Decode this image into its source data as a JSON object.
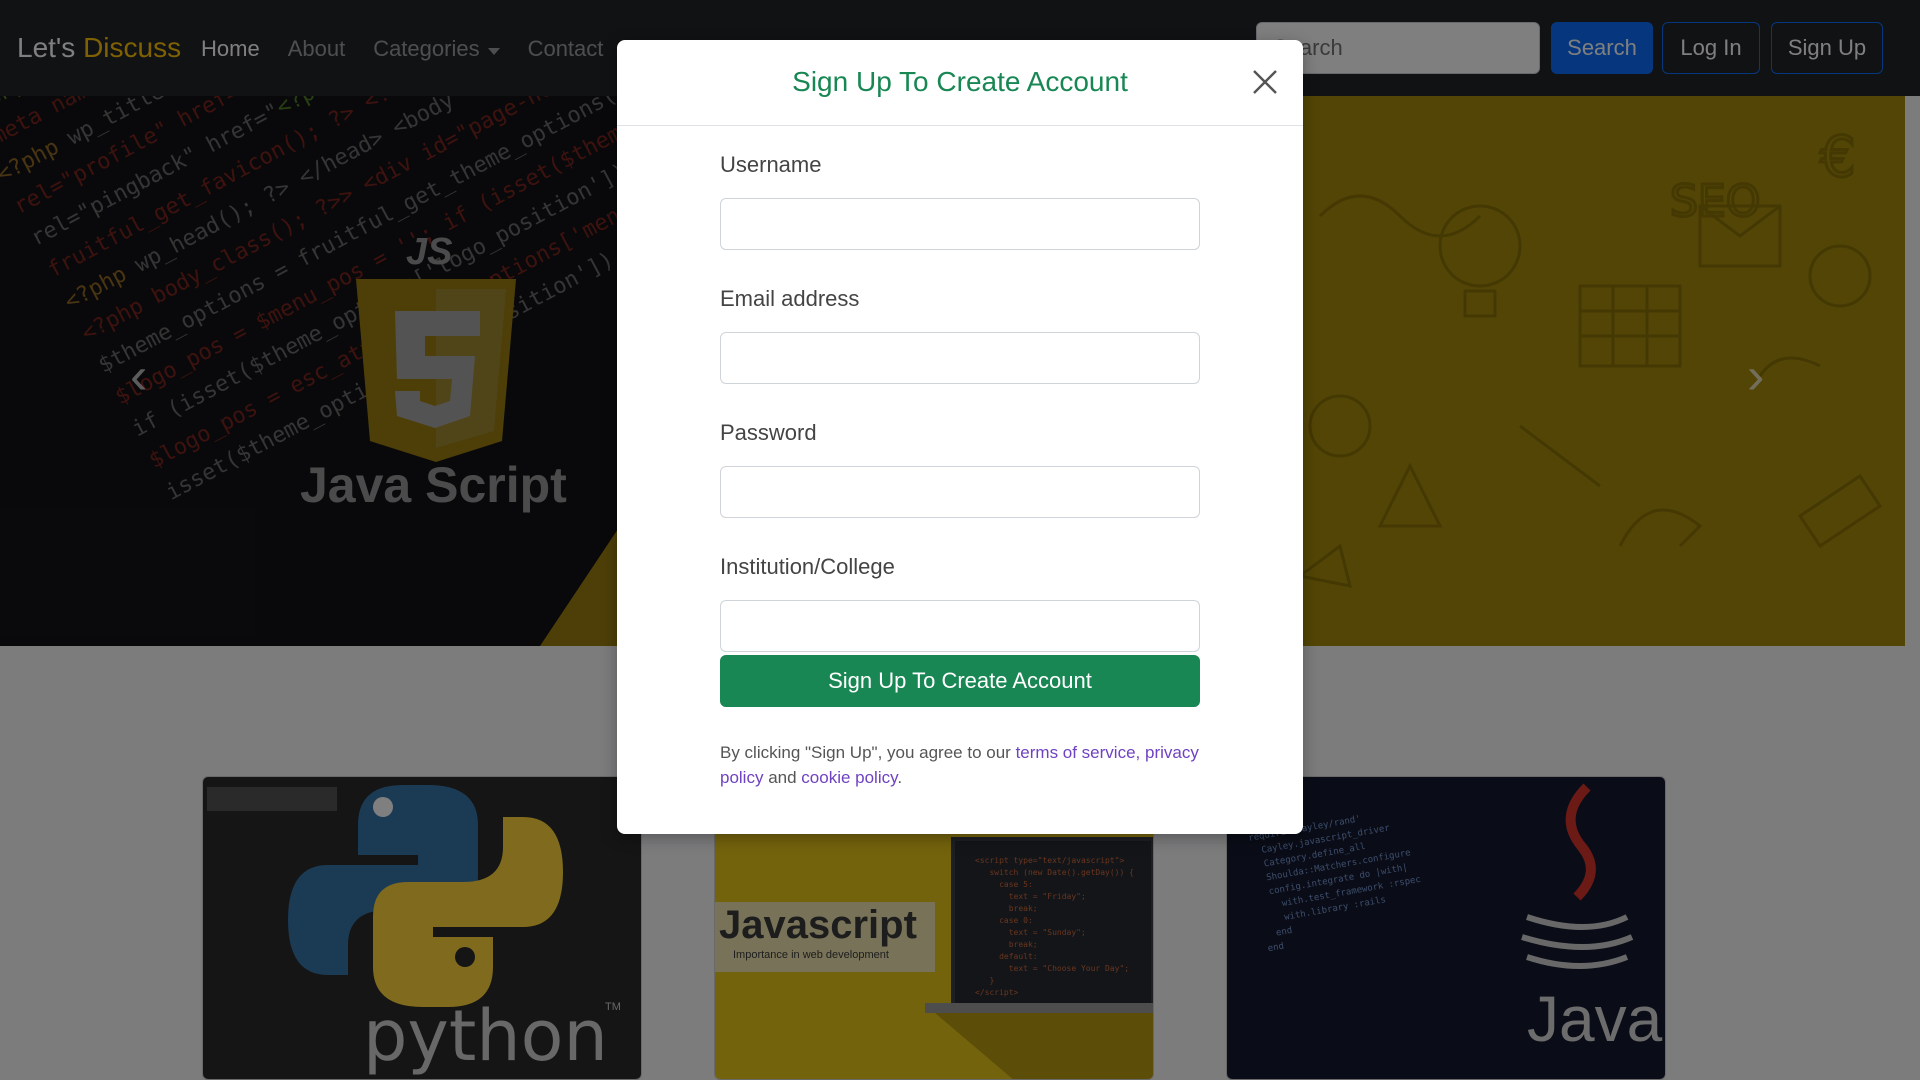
{
  "navbar": {
    "brand_first": "Let's",
    "brand_second": "Discuss",
    "links": [
      "Home",
      "About",
      "Categories",
      "Contact"
    ],
    "search_placeholder": "Search",
    "search_button": "Search",
    "login_button": "Log In",
    "signup_button": "Sign Up"
  },
  "carousel": {
    "slide_text_top": "JS",
    "slide_text_bottom": "Java Script",
    "prev_label": "‹",
    "next_label": "›"
  },
  "cards": [
    {
      "label": "python",
      "mark": "TM"
    },
    {
      "label": "Javascript",
      "sublabel": "Importance in web development"
    },
    {
      "label": "Java"
    }
  ],
  "modal": {
    "title": "Sign Up To Create Account",
    "fields": [
      {
        "label": "Username"
      },
      {
        "label": "Email address"
      },
      {
        "label": "Password"
      },
      {
        "label": "Institution/College"
      }
    ],
    "submit_label": "Sign Up To Create Account",
    "legal_prefix": "By clicking \"Sign Up\", you agree to our ",
    "legal_terms": "terms of service,",
    "legal_privacy": "privacy policy",
    "legal_and": " and ",
    "legal_cookie": "cookie policy",
    "legal_end": "."
  },
  "colors": {
    "navbar_bg": "#212529",
    "brand_accent": "#ffc107",
    "primary": "#0d6efd",
    "success": "#198754",
    "link": "#6f42c1",
    "slide_yellow": "#ffd512"
  }
}
